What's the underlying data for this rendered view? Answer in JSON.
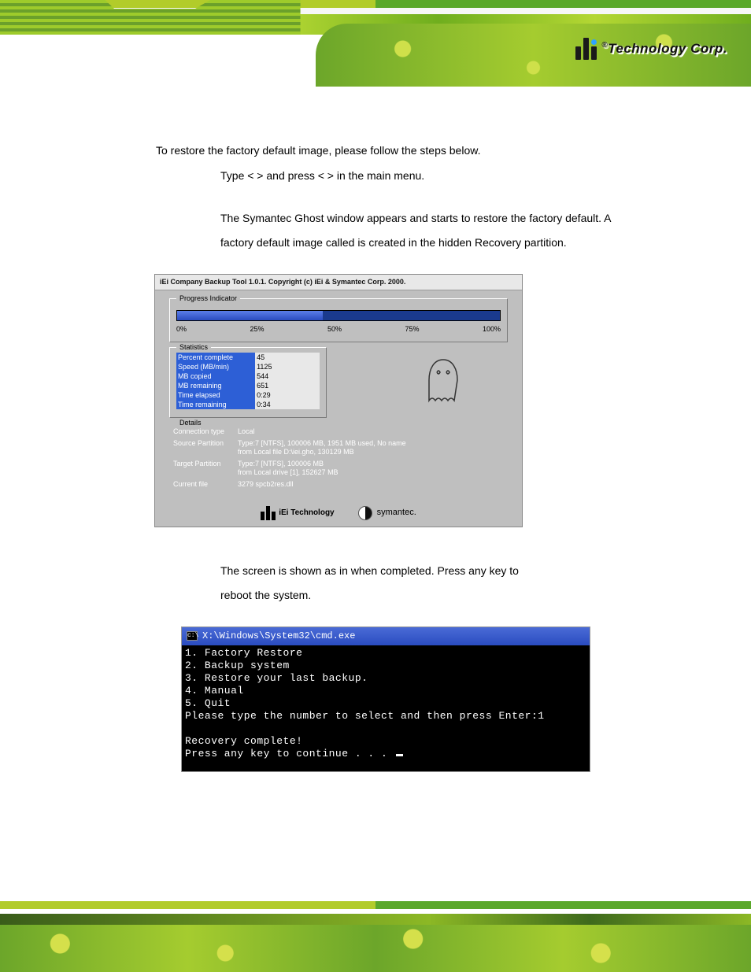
{
  "brand": {
    "reg": "®",
    "name": "Technology Corp."
  },
  "intro": "To restore the factory default image, please follow the steps below.",
  "step1": "Type <  > and press <        > in the main menu.",
  "step2a": "The Symantec Ghost window appears and starts to restore the factory default. A",
  "step2b": "factory default image called                 is created in the hidden Recovery partition.",
  "step3a": "The screen is shown as in                        when completed. Press any key to",
  "step3b": "reboot the system.",
  "ghost": {
    "title": "iEi Company Backup Tool 1.0.1.   Copyright (c) iEi & Symantec Corp. 2000.",
    "progress_label": "Progress Indicator",
    "ticks": [
      "0%",
      "25%",
      "50%",
      "75%",
      "100%"
    ],
    "stats_label": "Statistics",
    "stats": [
      [
        "Percent complete",
        "45"
      ],
      [
        "Speed (MB/min)",
        "1125"
      ],
      [
        "MB copied",
        "544"
      ],
      [
        "MB remaining",
        "651"
      ],
      [
        "Time elapsed",
        "0:29"
      ],
      [
        "Time remaining",
        "0:34"
      ]
    ],
    "details_label": "Details",
    "details": [
      [
        "Connection type",
        "Local"
      ],
      [
        "Source Partition",
        "Type:7 [NTFS], 100006 MB, 1951 MB used, No name\nfrom Local file D:\\iei.gho, 130129 MB"
      ],
      [
        "Target Partition",
        "Type:7 [NTFS], 100006 MB\nfrom Local drive [1], 152627 MB"
      ],
      [
        "Current file",
        "3279 spcb2res.dll"
      ]
    ],
    "iei": "iEi Technology",
    "symantec": "symantec."
  },
  "cmd": {
    "title": "X:\\Windows\\System32\\cmd.exe",
    "lines": "1. Factory Restore\n2. Backup system\n3. Restore your last backup.\n4. Manual\n5. Quit\nPlease type the number to select and then press Enter:1\n\nRecovery complete!\nPress any key to continue . . . "
  }
}
